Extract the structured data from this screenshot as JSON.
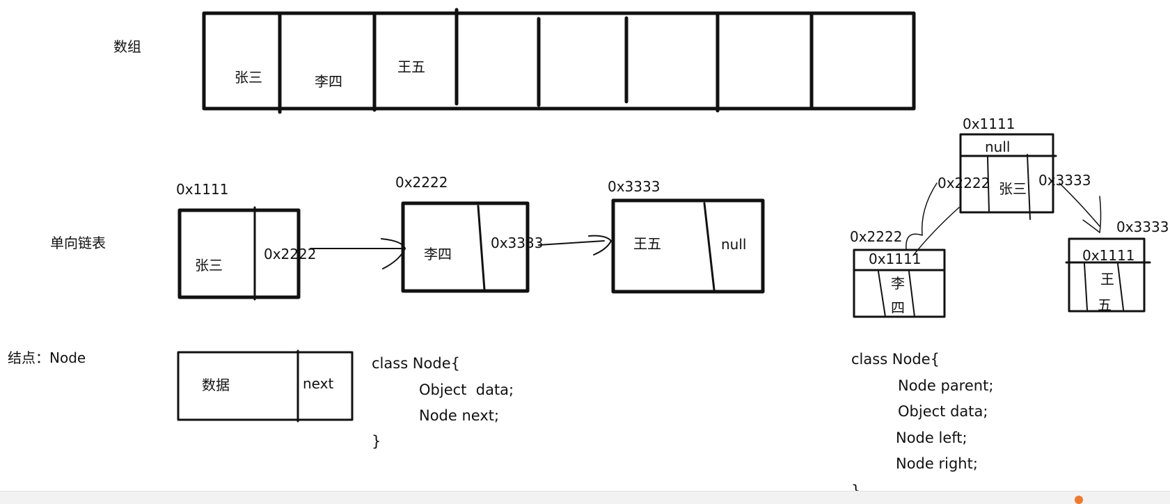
{
  "labels": {
    "array": "数组",
    "linked_list": "单向链表",
    "node": "结点：Node"
  },
  "array": {
    "cells": [
      "张三",
      "李四",
      "王五",
      "",
      "",
      "",
      "",
      ""
    ]
  },
  "linked_list": {
    "nodes": [
      {
        "address": "0x1111",
        "data": "张三",
        "next": "0x2222"
      },
      {
        "address": "0x2222",
        "data": "李四",
        "next": "0x3333"
      },
      {
        "address": "0x3333",
        "data": "王五",
        "next": "null"
      }
    ]
  },
  "node_struct": {
    "data_label": "数据",
    "next_label": "next",
    "code": [
      "class Node{",
      "Object  data;",
      "Node next;",
      "}"
    ]
  },
  "tree": {
    "root": {
      "address": "0x1111",
      "parent": "null",
      "left": "0x2222",
      "data": "张三",
      "right": "0x3333"
    },
    "left": {
      "address": "0x2222",
      "parent": "0x1111",
      "data_chars": [
        "李",
        "四"
      ]
    },
    "right": {
      "address": "0x3333",
      "parent": "0x1111",
      "data_chars": [
        "王",
        "五"
      ]
    },
    "code": [
      "class Node{",
      "Node parent;",
      "Object data;",
      "Node left;",
      "Node right;",
      "}"
    ]
  },
  "colors": {
    "ink": "#111111",
    "background": "#ffffff"
  }
}
